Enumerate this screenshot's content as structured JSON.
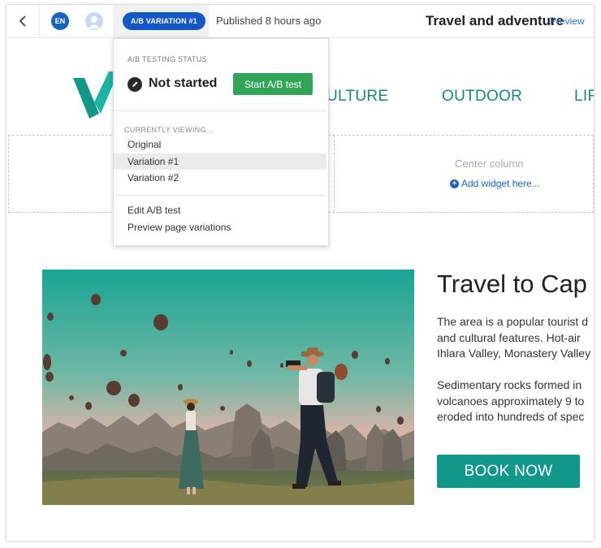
{
  "topbar": {
    "language_badge": "EN",
    "variation_pill": "A/B VARIATION #1",
    "published_text": "Published 8 hours ago",
    "page_title": "Travel and adventure",
    "preview_label": "Preview"
  },
  "site": {
    "nav_items": [
      "CULTURE",
      "OUTDOOR",
      "LIF"
    ],
    "center_column_label": "Center column",
    "add_widget_label": "Add widget here..."
  },
  "hero": {
    "title": "Travel to Cap",
    "paragraph1": [
      "The area is a popular tourist d",
      "and cultural features. Hot-air",
      "Ihlara Valley, Monastery Valley"
    ],
    "paragraph2": [
      "Sedimentary rocks formed in",
      "volcanoes approximately 9 to",
      "eroded into hundreds of spec"
    ],
    "book_button": "BOOK NOW"
  },
  "dropdown": {
    "status_label": "A/B TESTING STATUS",
    "status_text": "Not started",
    "start_button": "Start A/B test",
    "viewing_label": "CURRENTLY VIEWING...",
    "variations": [
      "Original",
      "Variation #1",
      "Variation #2"
    ],
    "active_variation": "Variation #1",
    "actions": [
      "Edit A/B test",
      "Preview page variations"
    ]
  },
  "colors": {
    "brand_teal": "#12988a",
    "pill_blue": "#1458c7",
    "start_green": "#33a559",
    "link_blue": "#2c73d2"
  }
}
